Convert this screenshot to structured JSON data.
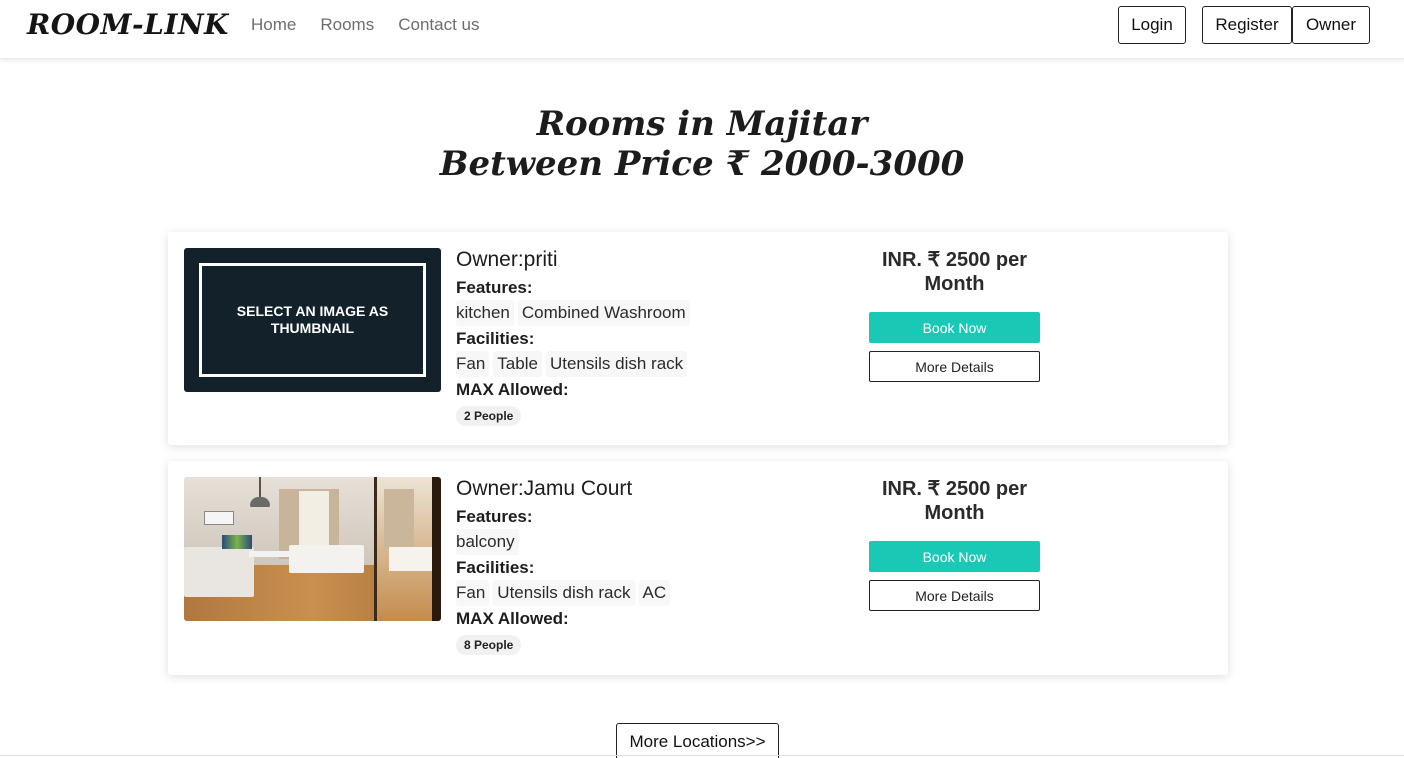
{
  "navbar": {
    "brand": "ROOM-LINK",
    "links": [
      "Home",
      "Rooms",
      "Contact us"
    ],
    "login_label": "Login",
    "register_label": "Register",
    "owner_label": "Owner"
  },
  "heading": {
    "line1": "Rooms in Majitar",
    "line2": "Between Price ₹ 2000-3000"
  },
  "labels": {
    "features": "Features:",
    "facilities": "Facilities:",
    "max_allowed": "MAX Allowed:",
    "book_now": "Book Now",
    "more_details": "More Details"
  },
  "rooms": [
    {
      "owner": "Owner:priti",
      "thumbnail_text": "SELECT AN IMAGE AS THUMBNAIL",
      "features": [
        "kitchen",
        "Combined Washroom"
      ],
      "facilities": [
        "Fan",
        "Table",
        "Utensils dish rack"
      ],
      "max_allowed": "2 People",
      "price": "INR. ₹ 2500 per Month"
    },
    {
      "owner": "Owner:Jamu Court",
      "features": [
        "balcony"
      ],
      "facilities": [
        "Fan",
        "Utensils dish rack",
        "AC"
      ],
      "max_allowed": "8 People",
      "price": "INR. ₹ 2500 per Month"
    }
  ],
  "more_locations_label": "More Locations>>",
  "colors": {
    "accent": "#19c9b6",
    "thumbnail_bg": "#13212b"
  }
}
